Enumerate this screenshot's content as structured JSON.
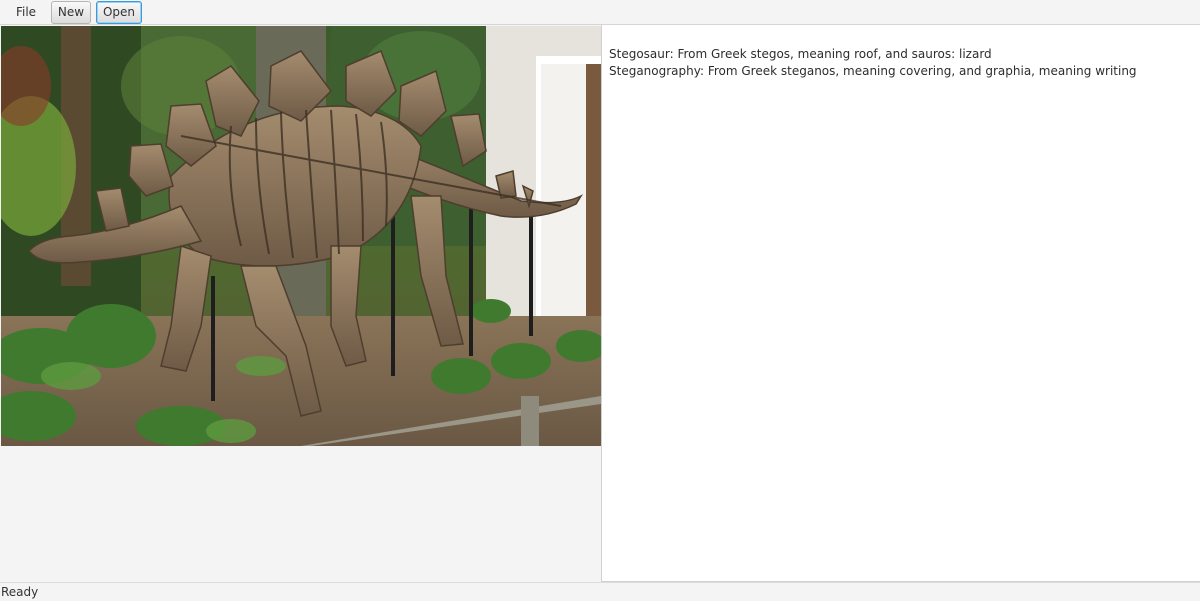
{
  "toolbar": {
    "file_label": "File",
    "new_label": "New",
    "open_label": "Open"
  },
  "content": {
    "lines": [
      "Stegosaur: From Greek stegos, meaning roof, and sauros: lizard",
      "Steganography: From Greek steganos, meaning covering, and graphia, meaning writing"
    ]
  },
  "status": {
    "text": "Ready"
  },
  "colors": {
    "focus_border": "#3a9bd8",
    "pane_background": "#ffffff",
    "window_background": "#f4f4f4"
  }
}
